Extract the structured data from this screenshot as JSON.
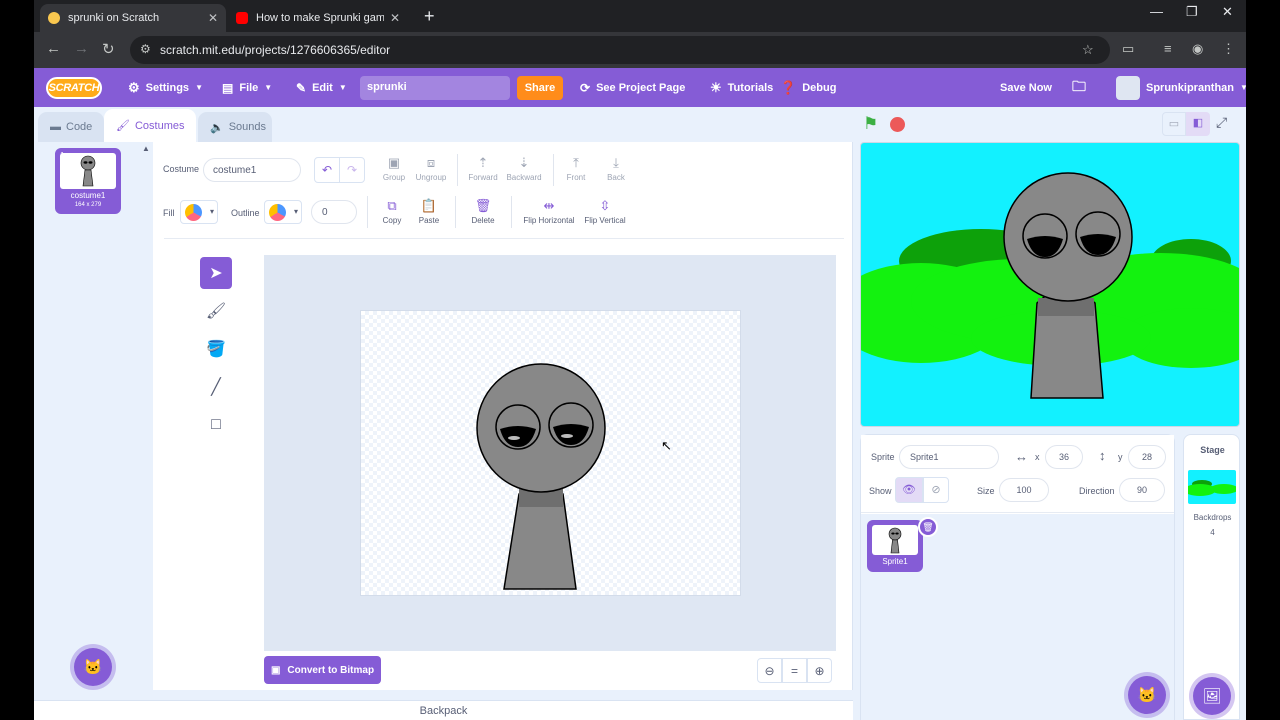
{
  "browser": {
    "tabs": [
      {
        "title": "sprunki on Scratch",
        "favicon_color": "#f9c74f"
      },
      {
        "title": "How to make Sprunki game in",
        "favicon_color": "#ff0000"
      }
    ],
    "url": "scratch.mit.edu/projects/1276606365/editor"
  },
  "menu": {
    "logo": "SCRATCH",
    "settings": "Settings",
    "file": "File",
    "edit": "Edit",
    "project_title": "sprunki",
    "share": "Share",
    "see_project_page": "See Project Page",
    "tutorials": "Tutorials",
    "debug": "Debug",
    "save_now": "Save Now",
    "username": "Sprunkipranthan"
  },
  "editor_tabs": {
    "code": "Code",
    "costumes": "Costumes",
    "sounds": "Sounds"
  },
  "costume_list": [
    {
      "index": "1",
      "name": "costume1",
      "size": "164 x 279"
    }
  ],
  "paint": {
    "costume_label": "Costume",
    "costume_name": "costume1",
    "group": "Group",
    "ungroup": "Ungroup",
    "forward": "Forward",
    "backward": "Backward",
    "front": "Front",
    "back": "Back",
    "fill_label": "Fill",
    "outline_label": "Outline",
    "outline_width": "0",
    "copy": "Copy",
    "paste": "Paste",
    "delete": "Delete",
    "flip_h": "Flip Horizontal",
    "flip_v": "Flip Vertical",
    "convert": "Convert to Bitmap",
    "zoom_reset": "="
  },
  "backpack": "Backpack",
  "sprite_info": {
    "sprite_label": "Sprite",
    "sprite_name": "Sprite1",
    "x_label": "x",
    "x": "36",
    "y_label": "y",
    "y": "28",
    "show_label": "Show",
    "size_label": "Size",
    "size": "100",
    "direction_label": "Direction",
    "direction": "90"
  },
  "sprites": [
    {
      "name": "Sprite1"
    }
  ],
  "stage_panel": {
    "title": "Stage",
    "backdrops_label": "Backdrops",
    "backdrops_count": "4"
  },
  "colors": {
    "accent": "#855cd6",
    "share": "#ff8c1a",
    "stage_bg": "#12f1ff",
    "bush": "#13f20f",
    "bush_dark": "#0da10a"
  }
}
